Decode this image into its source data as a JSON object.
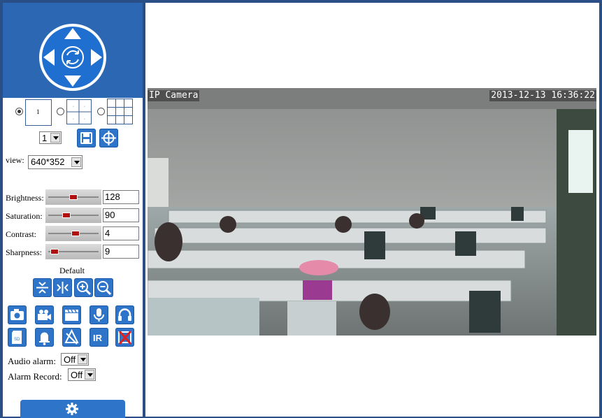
{
  "layout": {
    "preset_selected": "1",
    "preset_options": [
      "1"
    ],
    "single_label": "1"
  },
  "view": {
    "label": "view:",
    "value": "640*352"
  },
  "image_settings": [
    {
      "label": "Brightness:",
      "value": "128",
      "level": 0.5
    },
    {
      "label": "Saturation:",
      "value": "90",
      "level": 0.35
    },
    {
      "label": "Contrast:",
      "value": "4",
      "level": 0.55
    },
    {
      "label": "Sharpness:",
      "value": "9",
      "level": 0.1
    }
  ],
  "default_label": "Default",
  "audio_alarm": {
    "label": "Audio alarm:",
    "value": "Off"
  },
  "alarm_record": {
    "label": "Alarm Record:",
    "value": "Off"
  },
  "video": {
    "osd_title": "IP Camera",
    "osd_timestamp": "2013-12-13 16:36:22"
  },
  "colors": {
    "frame": "#2a4f86",
    "accent": "#2e74c8",
    "ptz_bg": "#2b67b3"
  }
}
